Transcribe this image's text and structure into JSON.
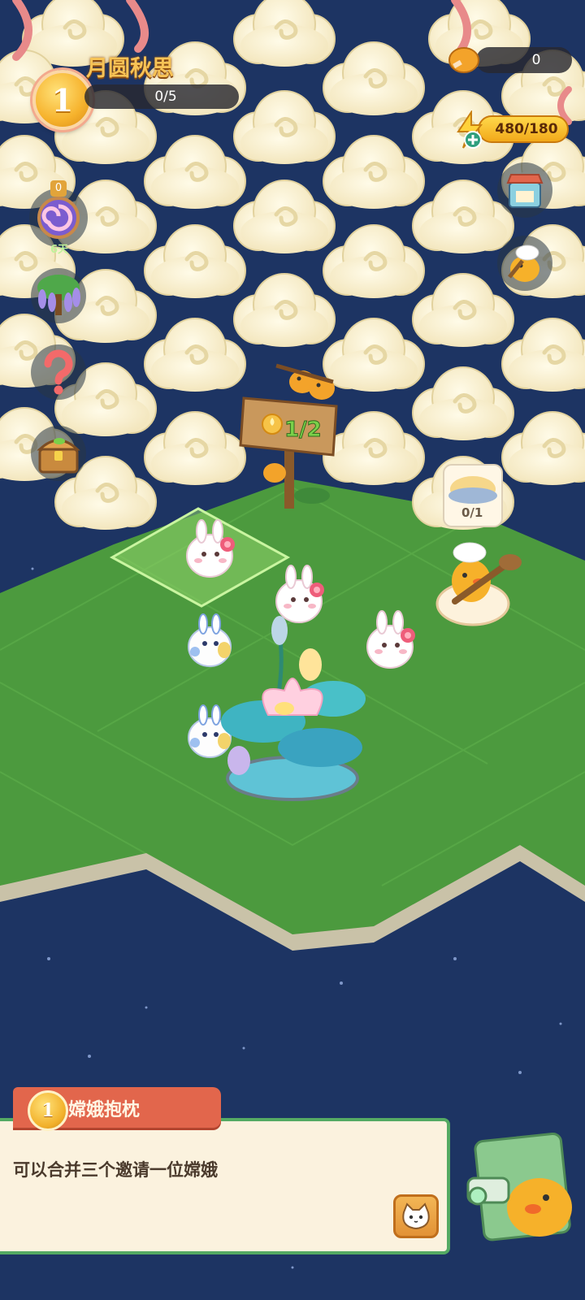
{
  "event": {
    "level": "1",
    "title": "月圆秋思",
    "progress": "0/5"
  },
  "resources": {
    "coins": "0",
    "energy": "480/180"
  },
  "side_buttons": {
    "pass_count": "0",
    "pass_days": "6天"
  },
  "board": {
    "sign_progress": "1/2",
    "chef_order_progress": "0/1"
  },
  "task_card": {
    "level": "1",
    "title": "嫦娥抱枕",
    "description": "可以合并三个邀请一位嫦娥"
  },
  "colors": {
    "sky": "#1d3463",
    "grass": "#4c9a3e",
    "cloud": "#fbf3d4",
    "accent_orange": "#e2664c",
    "card_border": "#54aa63"
  }
}
